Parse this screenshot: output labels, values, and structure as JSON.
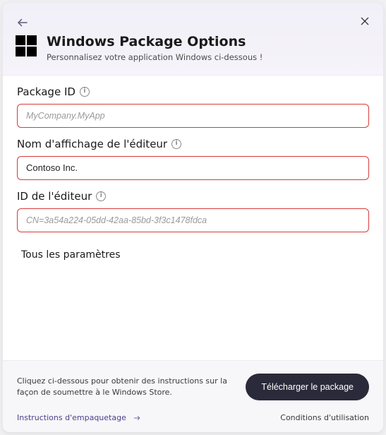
{
  "header": {
    "title": "Windows Package Options",
    "subtitle": "Personnalisez votre application Windows ci-dessous !"
  },
  "fields": {
    "packageId": {
      "label": "Package ID",
      "placeholder": "MyCompany.MyApp",
      "value": ""
    },
    "publisherDisplayName": {
      "label": "Nom d'affichage de l'éditeur",
      "placeholder": "",
      "value": "Contoso Inc."
    },
    "publisherId": {
      "label": "ID de l'éditeur",
      "placeholder": "CN=3a54a224-05dd-42aa-85bd-3f3c1478fdca",
      "value": ""
    }
  },
  "allSettings": "Tous les paramètres",
  "footer": {
    "helpText": "Cliquez ci-dessous pour obtenir des instructions sur la façon de soumettre à le Windows Store.",
    "downloadLabel": "Télécharger le package",
    "packagingInstructions": "Instructions d'empaquetage",
    "terms": "Conditions d'utilisation"
  },
  "infoGlyph": "i"
}
